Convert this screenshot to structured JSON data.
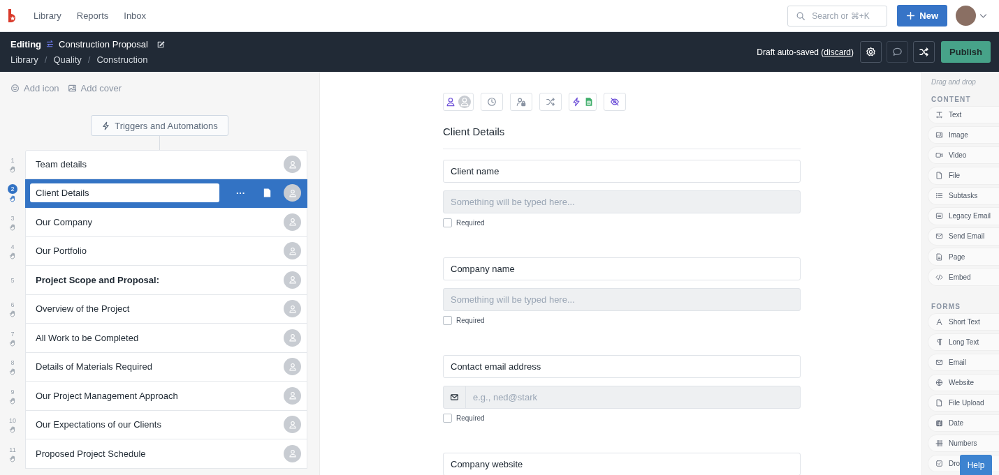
{
  "nav": {
    "links": [
      "Library",
      "Reports",
      "Inbox"
    ],
    "search": {
      "placeholder": "Search or ⌘+K"
    },
    "new_button": "New"
  },
  "editor_bar": {
    "mode": "Editing",
    "title": "Construction Proposal",
    "breadcrumb": [
      "Library",
      "Quality",
      "Construction"
    ],
    "breadcrumb_separator": "/",
    "autosave": {
      "prefix": "Draft auto-saved (",
      "link": "discard",
      "suffix": ")"
    },
    "publish": "Publish"
  },
  "left": {
    "add_icon": "Add icon",
    "add_cover": "Add cover",
    "triggers": "Triggers and Automations",
    "steps": [
      {
        "number": "1",
        "title": "Team details",
        "kind": "step",
        "selected": false
      },
      {
        "number": "2",
        "title": "Client Details",
        "kind": "step",
        "selected": true
      },
      {
        "number": "3",
        "title": "Our Company",
        "kind": "step",
        "selected": false
      },
      {
        "number": "4",
        "title": "Our Portfolio",
        "kind": "step",
        "selected": false
      },
      {
        "number": "5",
        "title": "Project Scope and Proposal:",
        "kind": "heading",
        "selected": false
      },
      {
        "number": "6",
        "title": "Overview of the Project",
        "kind": "step",
        "selected": false
      },
      {
        "number": "7",
        "title": "All Work to be Completed",
        "kind": "step",
        "selected": false
      },
      {
        "number": "8",
        "title": "Details of Materials Required",
        "kind": "step",
        "selected": false
      },
      {
        "number": "9",
        "title": "Our Project Management Approach",
        "kind": "step",
        "selected": false
      },
      {
        "number": "10",
        "title": "Our Expectations of our Clients",
        "kind": "step",
        "selected": false
      },
      {
        "number": "11",
        "title": "Proposed Project Schedule",
        "kind": "step",
        "selected": false
      }
    ],
    "more": "···"
  },
  "canvas": {
    "section_title": "Client Details",
    "fields": [
      {
        "kind": "text",
        "label": "Client name",
        "placeholder": "Something will be typed here...",
        "required_label": "Required",
        "required": false
      },
      {
        "kind": "text",
        "label": "Company name",
        "placeholder": "Something will be typed here...",
        "required_label": "Required",
        "required": false
      },
      {
        "kind": "email",
        "label": "Contact email address",
        "placeholder": "e.g., ned@stark",
        "required_label": "Required",
        "required": false
      },
      {
        "kind": "partial",
        "label": "Company website"
      }
    ]
  },
  "palette": {
    "hint": "Drag and drop",
    "groups": [
      {
        "title": "CONTENT",
        "items": [
          "Text",
          "Image",
          "Video",
          "File",
          "Subtasks",
          "Legacy Email",
          "Send Email",
          "Page",
          "Embed"
        ]
      },
      {
        "title": "FORMS",
        "items": [
          "Short Text",
          "Long Text",
          "Email",
          "Website",
          "File Upload",
          "Date",
          "Numbers",
          "Dro"
        ]
      }
    ],
    "help": "Help"
  }
}
